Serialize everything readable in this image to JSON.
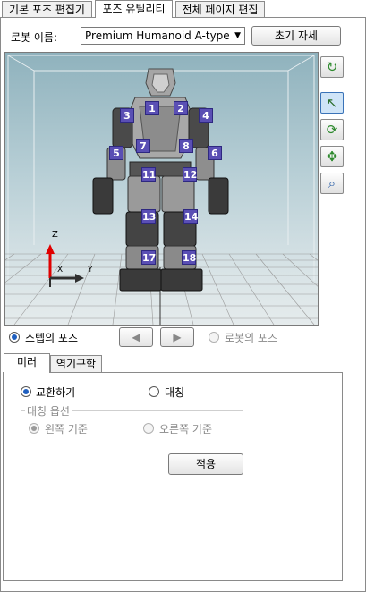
{
  "tabs": [
    {
      "label": "기본 포즈 편집기",
      "active": false
    },
    {
      "label": "포즈 유틸리티",
      "active": true
    },
    {
      "label": "전체 페이지 편집",
      "active": false
    }
  ],
  "robot": {
    "label": "로봇 이름:",
    "selected": "Premium Humanoid A-type",
    "init_button": "초기 자세"
  },
  "joints": [
    "1",
    "2",
    "3",
    "4",
    "5",
    "6",
    "7",
    "8",
    "11",
    "12",
    "13",
    "14",
    "17",
    "18"
  ],
  "axes": {
    "z": "Z",
    "x": "X",
    "y": "Y"
  },
  "toolbar": [
    {
      "icon": "rotate-view-icon"
    },
    {
      "icon": "select-arrow-icon",
      "active": true
    },
    {
      "icon": "orbit-icon"
    },
    {
      "icon": "pan-icon"
    },
    {
      "icon": "zoom-icon"
    }
  ],
  "pose_source": {
    "step_pose": "스텝의 포즈",
    "robot_pose": "로봇의 포즈",
    "selected": "step"
  },
  "subtabs": [
    {
      "label": "미러",
      "active": true
    },
    {
      "label": "역기구학",
      "active": false
    }
  ],
  "mirror": {
    "swap": "교환하기",
    "symmetric": "대칭",
    "selected": "swap",
    "options_title": "대칭 옵션",
    "left_based": "왼쪽 기준",
    "right_based": "오른쪽 기준",
    "apply": "적용"
  }
}
